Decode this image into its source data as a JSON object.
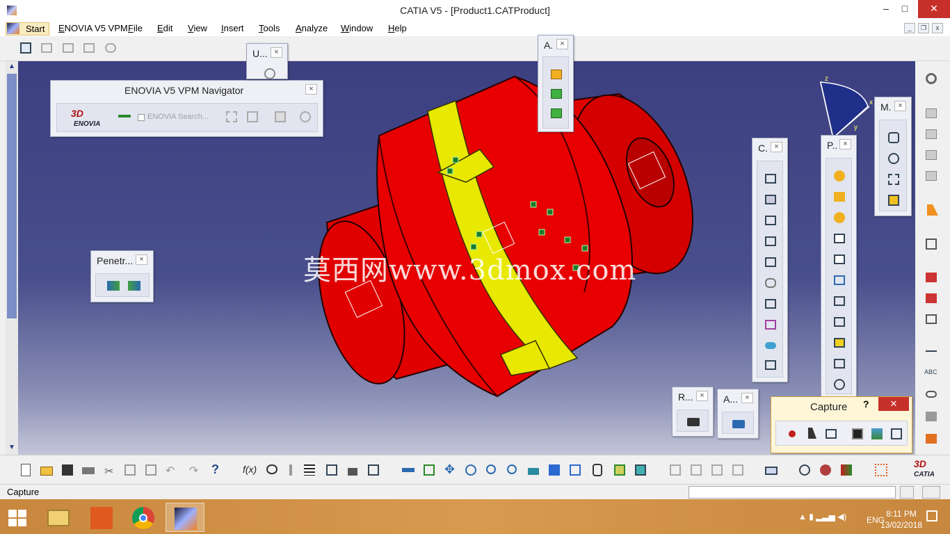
{
  "window": {
    "title": "CATIA V5 - [Product1.CATProduct]",
    "minimize": "–",
    "maximize": "□",
    "close": "✕"
  },
  "menubar": {
    "start": "Start",
    "items": [
      "ENOVIA V5 VPM",
      "File",
      "Edit",
      "View",
      "Insert",
      "Tools",
      "Analyze",
      "Window",
      "Help"
    ]
  },
  "palettes": {
    "enovia": {
      "title": "ENOVIA V5 VPM Navigator",
      "brand": "ENOVIA",
      "search": "ENOVIA Search...",
      "close": "×"
    },
    "u": {
      "title": "U...",
      "close": "×"
    },
    "a_top": {
      "title": "A.",
      "close": "×"
    },
    "penetr": {
      "title": "Penetr...",
      "close": "×"
    },
    "c": {
      "title": "C.",
      "close": "×"
    },
    "p": {
      "title": "P..",
      "close": "×"
    },
    "m": {
      "title": "M.",
      "close": "×"
    },
    "r": {
      "title": "R...",
      "close": "×"
    },
    "a_bottom": {
      "title": "A...",
      "close": "×"
    },
    "capture": {
      "title": "Capture",
      "help": "?",
      "close": "✕"
    }
  },
  "compass": {
    "x": "x",
    "y": "y",
    "z": "z"
  },
  "watermark": "莫西网www.3dmox.com",
  "status": {
    "text": "Capture"
  },
  "taskbar": {
    "lang": "ENG",
    "time": "8:11 PM",
    "date": "13/02/2018"
  },
  "brand": {
    "catia": "CATIA"
  },
  "colors": {
    "part_red": "#e50000",
    "part_yellow": "#e8e800",
    "viewport_top": "#3c3f80",
    "taskbar": "#cf9147"
  },
  "icons": {
    "bottom_toolbar": [
      "new-icon",
      "open-icon",
      "save-icon",
      "print-icon",
      "cut-icon",
      "copy-icon",
      "paste-icon",
      "undo-icon",
      "redo-icon",
      "whats-this-icon",
      "formula-icon",
      "knowledge-icon",
      "tools-icon",
      "table-icon",
      "tree-icon",
      "lock-icon",
      "options-icon",
      "fly-icon",
      "fit-all-icon",
      "pan-icon",
      "rotate-icon",
      "zoom-in-icon",
      "zoom-out-icon",
      "normal-view-icon",
      "multi-view-icon",
      "iso-view-icon",
      "shading-icon",
      "hide-show-icon",
      "swap-icon",
      "arrows-icon",
      "filter-icon",
      "link-icon",
      "measure-icon",
      "catalog-icon",
      "compass-icon",
      "material-icon",
      "grid-icon"
    ]
  }
}
